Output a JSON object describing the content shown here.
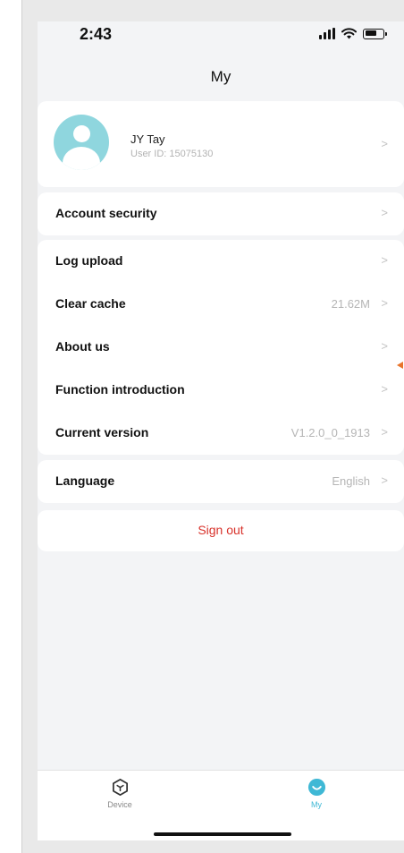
{
  "status_bar": {
    "time": "2:43"
  },
  "nav": {
    "title": "My"
  },
  "profile": {
    "name": "JY Tay",
    "user_id": "User ID: 15075130"
  },
  "settings": {
    "account_security": {
      "label": "Account security"
    },
    "log_upload": {
      "label": "Log upload"
    },
    "clear_cache": {
      "label": "Clear cache",
      "value": "21.62M"
    },
    "about_us": {
      "label": "About us"
    },
    "function_intro": {
      "label": "Function introduction"
    },
    "current_version": {
      "label": "Current version",
      "value": "V1.2.0_0_1913"
    },
    "language": {
      "label": "Language",
      "value": "English"
    }
  },
  "sign_out": {
    "label": "Sign out"
  },
  "tabs": [
    {
      "label": "Device",
      "icon": "device-cube-icon"
    },
    {
      "label": "My",
      "icon": "smile-face-icon",
      "active": true
    }
  ],
  "colors": {
    "accent": "#3fb8d5",
    "danger": "#d8322b",
    "background": "#f3f4f6",
    "marker": "#e8742b"
  }
}
